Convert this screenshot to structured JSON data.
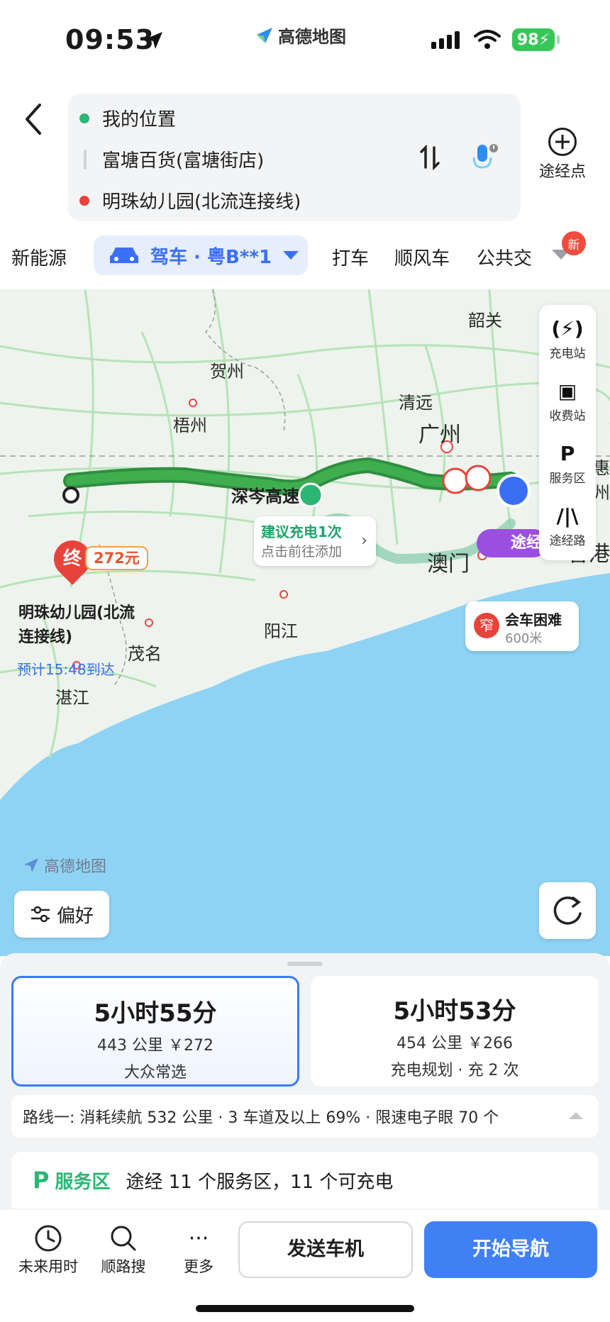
{
  "status": {
    "time": "09:53",
    "app_name": "高德地图",
    "battery": "98"
  },
  "route": {
    "origin": "我的位置",
    "via": "富塘百货(富塘街店)",
    "destination": "明珠幼儿园(北流连接线)",
    "waypoint_label": "途经点"
  },
  "modes": {
    "new_energy": "新能源",
    "drive": "驾车 · 粤B**1",
    "taxi": "打车",
    "carpool": "顺风车",
    "transit": "公共交",
    "new_badge": "新"
  },
  "map": {
    "cities": [
      "韶关",
      "贺州",
      "梧州",
      "清远",
      "广州",
      "阳江",
      "茂名",
      "湛江",
      "澳门",
      "香港",
      "惠州"
    ],
    "road_label": "深岑高速",
    "watermark": "高德地图",
    "charge_tip": {
      "title": "建议充电1次",
      "subtitle": "点击前往添加"
    },
    "end": {
      "pin": "终",
      "cost": "272元",
      "name": "明珠幼儿园(北流连接线)",
      "eta": "预计15:48到达"
    },
    "waypoint_tag": "途经",
    "narrow": {
      "badge": "窄",
      "title": "会车困难",
      "distance": "600米"
    },
    "tools": [
      "充电站",
      "收费站",
      "服务区",
      "途经路"
    ],
    "preference": "偏好"
  },
  "routes": [
    {
      "duration": "5小时55分",
      "meta": "443 公里 ￥272",
      "tag": "大众常选",
      "selected": true
    },
    {
      "duration": "5小时53分",
      "meta": "454 公里 ￥266",
      "tag": "充电规划 · 充 2 次",
      "selected": false
    }
  ],
  "route_info": "路线一:  消耗续航 532 公里 · 3 车道及以上 69% · 限速电子眼 70 个",
  "service": {
    "label": "服务区",
    "text": "途经 11 个服务区，11 个可充电"
  },
  "bottom": {
    "future": "未来用时",
    "search_along": "顺路搜",
    "more": "更多",
    "send": "发送车机",
    "navigate": "开始导航"
  },
  "colors": {
    "accent": "#3f80f5",
    "route_green": "#2fa84f",
    "sea": "#8fd3f4"
  }
}
